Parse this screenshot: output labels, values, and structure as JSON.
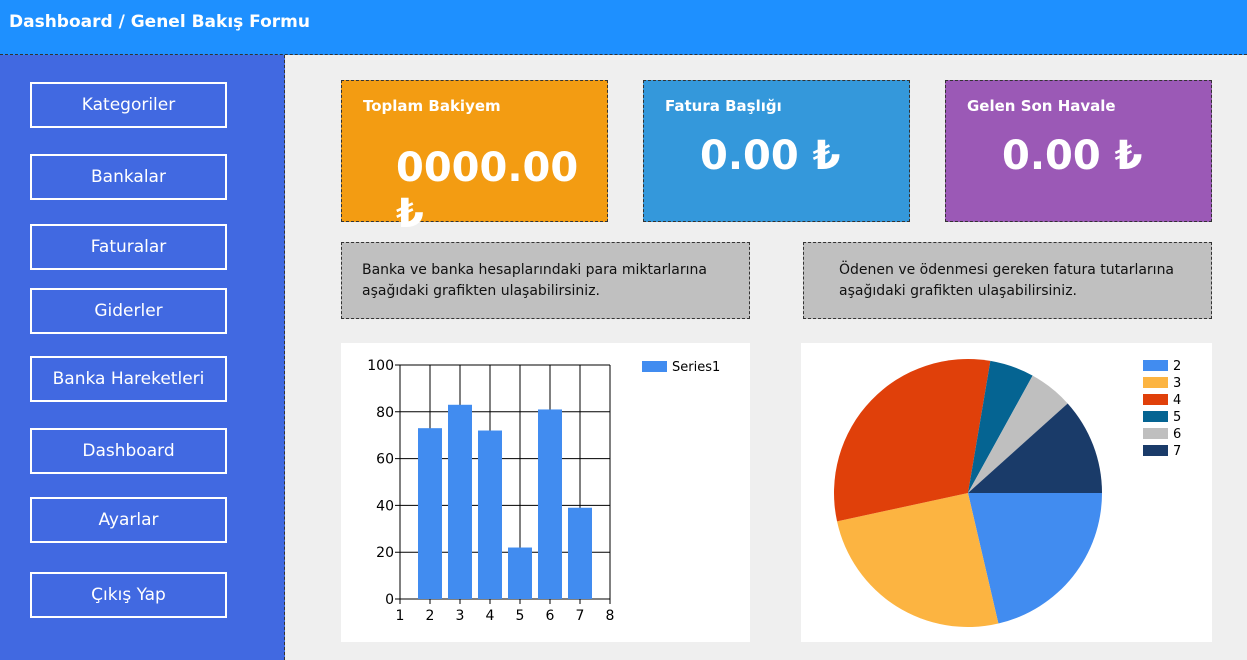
{
  "window": {
    "title": "Dashboard / Genel Bakış Formu"
  },
  "sidebar": {
    "items": [
      {
        "label": "Kategoriler"
      },
      {
        "label": "Bankalar"
      },
      {
        "label": "Faturalar"
      },
      {
        "label": "Giderler"
      },
      {
        "label": "Banka Hareketleri"
      },
      {
        "label": "Dashboard"
      },
      {
        "label": "Ayarlar"
      },
      {
        "label": "Çıkış Yap"
      }
    ]
  },
  "cards": [
    {
      "label": "Toplam Bakiyem",
      "value": "0000.00 ₺",
      "color": "#f39c12"
    },
    {
      "label": "Fatura Başlığı",
      "value": "0.00 ₺",
      "color": "#3498db"
    },
    {
      "label": "Gelen Son Havale",
      "value": "0.00 ₺",
      "color": "#9b59b6"
    }
  ],
  "info": {
    "left": "Banka ve banka hesaplarındaki para miktarlarına aşağıdaki grafikten ulaşabilirsiniz.",
    "right": "Ödenen ve ödenmesi gereken fatura tutarlarına aşağıdaki grafikten ulaşabilirsiniz."
  },
  "chart_data": [
    {
      "type": "bar",
      "x": [
        2,
        3,
        4,
        5,
        6,
        7
      ],
      "series": [
        {
          "name": "Series1",
          "values": [
            73,
            83,
            72,
            22,
            81,
            39
          ],
          "color": "#418cf0"
        }
      ],
      "xticks": [
        "1",
        "2",
        "3",
        "4",
        "5",
        "6",
        "7",
        "8"
      ],
      "yticks": [
        "0",
        "20",
        "40",
        "60",
        "80",
        "100"
      ],
      "xlim": [
        1,
        8
      ],
      "ylim": [
        0,
        100
      ],
      "grid": true,
      "legend": "top-right"
    },
    {
      "type": "pie",
      "labels": [
        "2",
        "3",
        "4",
        "5",
        "6",
        "7"
      ],
      "values": [
        22,
        26,
        32,
        5.5,
        5.5,
        12
      ],
      "colors": [
        "#418cf0",
        "#fcb441",
        "#e0400a",
        "#056492",
        "#bfbfbf",
        "#1a3b69"
      ],
      "legend": "top-right"
    }
  ]
}
